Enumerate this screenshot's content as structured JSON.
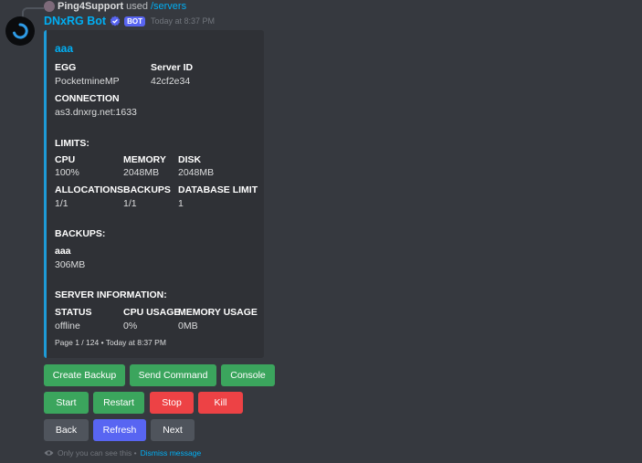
{
  "reply": {
    "user": "Ping4Support",
    "action": "used",
    "command": "/servers"
  },
  "message": {
    "author": "DNxRG Bot",
    "bot_tag": "BOT",
    "timestamp": "Today at 8:37 PM"
  },
  "embed": {
    "accent_color": "#1e9bd7",
    "title": "aaa",
    "egg_label": "EGG",
    "egg_value": "PocketmineMP",
    "server_id_label": "Server ID",
    "server_id_value": "42cf2e34",
    "connection_label": "CONNECTION",
    "connection_value": "as3.dnxrg.net:1633",
    "limits_heading": "LIMITS:",
    "cpu_label": "CPU",
    "cpu_value": "100%",
    "memory_label": "MEMORY",
    "memory_value": "2048MB",
    "disk_label": "DISK",
    "disk_value": "2048MB",
    "allocations_label": "ALLOCATIONS",
    "allocations_value": "1/1",
    "backups_label": "BACKUPS",
    "backups_value": "1/1",
    "database_label": "DATABASE LIMIT",
    "database_value": "1",
    "backups_heading": "BACKUPS:",
    "backup_name": "aaa",
    "backup_size": "306MB",
    "server_info_heading": "SERVER INFORMATION:",
    "status_label": "STATUS",
    "status_value": "offline",
    "cpu_usage_label": "CPU USAGE",
    "cpu_usage_value": "0%",
    "memory_usage_label": "MEMORY USAGE",
    "memory_usage_value": "0MB",
    "footer": "Page 1 / 124 • Today at 8:37 PM"
  },
  "buttons": {
    "create_backup": "Create Backup",
    "send_command": "Send Command",
    "console": "Console",
    "start": "Start",
    "restart": "Restart",
    "stop": "Stop",
    "kill": "Kill",
    "back": "Back",
    "refresh": "Refresh",
    "next": "Next"
  },
  "ephemeral": {
    "notice": "Only you can see this •",
    "dismiss": "Dismiss message"
  },
  "colors": {
    "success": "#3ba55d",
    "danger": "#ed4245",
    "secondary": "#4f545c",
    "primary": "#5865f2",
    "link": "#00aff4"
  }
}
